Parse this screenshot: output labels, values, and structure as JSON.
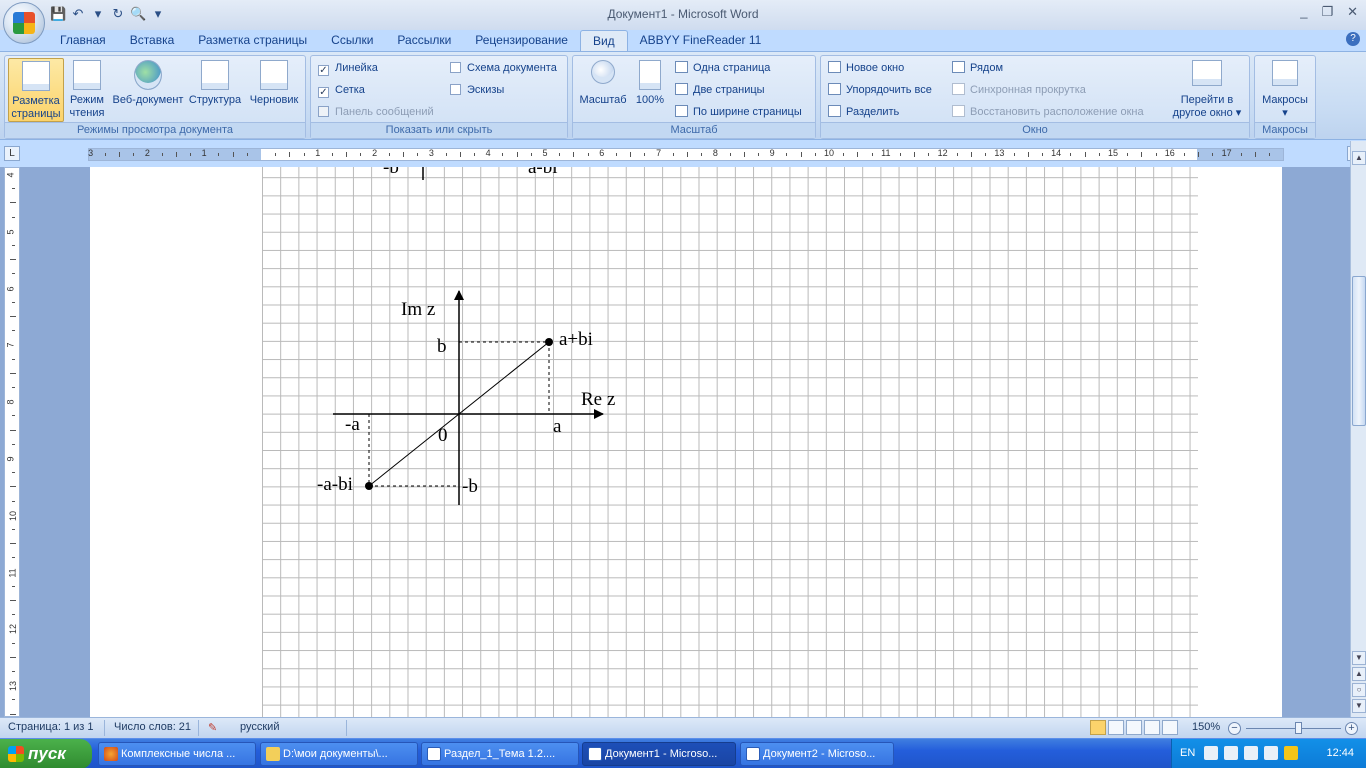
{
  "title_bar": {
    "title": "Документ1 - Microsoft Word",
    "min": "_",
    "max": "❐",
    "close": "✕"
  },
  "quick_access": {
    "save": "💾",
    "undo": "↶",
    "undo_menu": "▾",
    "redo": "↻",
    "preview": "🔍",
    "customize": "▾"
  },
  "tabs": [
    "Главная",
    "Вставка",
    "Разметка страницы",
    "Ссылки",
    "Рассылки",
    "Рецензирование",
    "Вид",
    "ABBYY FineReader 11"
  ],
  "active_tab": "Вид",
  "help": "?",
  "ribbon": {
    "group_views": {
      "label": "Режимы просмотра документа",
      "buttons": [
        {
          "l1": "Разметка",
          "l2": "страницы"
        },
        {
          "l1": "Режим",
          "l2": "чтения"
        },
        {
          "l1": "Веб-документ",
          "l2": ""
        },
        {
          "l1": "Структура",
          "l2": ""
        },
        {
          "l1": "Черновик",
          "l2": ""
        }
      ]
    },
    "group_show": {
      "label": "Показать или скрыть",
      "ruler": "Линейка",
      "grid": "Сетка",
      "messages": "Панель сообщений",
      "doc_map": "Схема документа",
      "thumbnails": "Эскизы",
      "check": "✓"
    },
    "group_zoom": {
      "label": "Масштаб",
      "zoom": "Масштаб",
      "hundred": "100%",
      "one_page": "Одна страница",
      "two_pages": "Две страницы",
      "page_width": "По ширине страницы"
    },
    "group_window": {
      "label": "Окно",
      "new_window": "Новое окно",
      "arrange_all": "Упорядочить все",
      "split": "Разделить",
      "side_by_side": "Рядом",
      "sync_scroll": "Синхронная прокрутка",
      "reset_position": "Восстановить расположение окна",
      "switch_l1": "Перейти в",
      "switch_l2": "другое окно ▾"
    },
    "group_macros": {
      "label": "Макросы",
      "macros": "Макросы",
      "arrow": "▾"
    }
  },
  "ruler": {
    "corner": "L",
    "numbers": [
      "3",
      "2",
      "1",
      "1",
      "2",
      "3",
      "4",
      "5",
      "6",
      "7",
      "8",
      "9",
      "10",
      "11",
      "12",
      "13",
      "14",
      "15",
      "16",
      "17"
    ],
    "vnumbers": [
      "4",
      "5",
      "6",
      "7",
      "8",
      "9",
      "10",
      "11",
      "12",
      "13"
    ]
  },
  "figure": {
    "top_left_fragment": "-b",
    "top_right_fragment": "a-bi",
    "im_label": "Im z",
    "re_label": "Re z",
    "b": "b",
    "neg_b": "-b",
    "a": "a",
    "neg_a": "-a",
    "origin": "0",
    "point": "a+bi",
    "neg_point": "-a-bi"
  },
  "status": {
    "page": "Страница: 1 из 1",
    "words": "Число слов: 21",
    "lang": "русский",
    "zoom": "150%",
    "minus": "−",
    "plus": "+"
  },
  "taskbar": {
    "start": "пуск",
    "items": [
      "Комплексные числа ...",
      "D:\\мои документы\\...",
      "Раздел_1_Тема 1.2....",
      "Документ1 - Microso...",
      "Документ2 - Microso..."
    ],
    "lang": "EN",
    "clock": "12:44"
  },
  "colors": {
    "accent": "#15428b",
    "active_button": "#fbd36b",
    "taskbar": "#245edb",
    "start": "#2f8a2f"
  }
}
